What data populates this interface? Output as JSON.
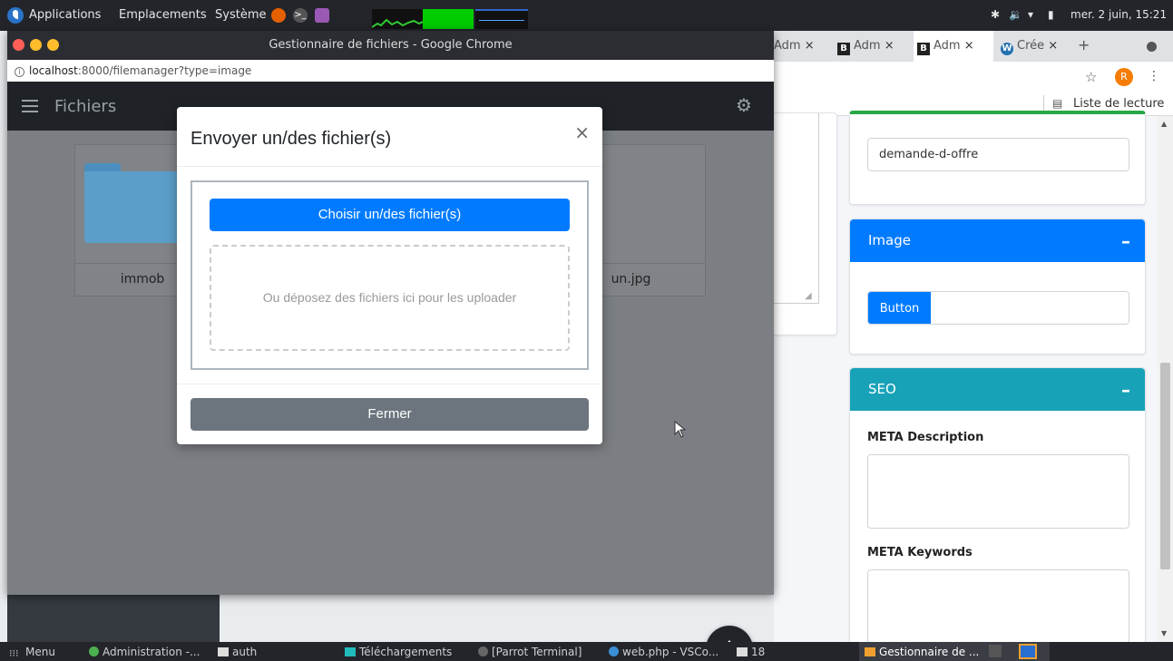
{
  "system_bar": {
    "menus": [
      "Applications",
      "Emplacements",
      "Système"
    ],
    "datetime": "mer. 2 juin, 15:21"
  },
  "file_manager_window": {
    "title": "Gestionnaire de fichiers - Google Chrome",
    "url_host": "localhost",
    "url_rest": ":8000/filemanager?type=image",
    "nav_title": "Fichiers",
    "files": [
      {
        "name": "immob",
        "kind": "folder"
      },
      {
        "name": "un.jpg",
        "kind": "image"
      }
    ],
    "fab_label": "+"
  },
  "modal": {
    "title": "Envoyer un/des fichier(s)",
    "close_label": "×",
    "choose_label": "Choisir un/des fichier(s)",
    "dropzone_text": "Ou déposez des fichiers ici pour les uploader",
    "close_button_label": "Fermer"
  },
  "background_browser": {
    "tabs": [
      {
        "label": "Adm",
        "icon": ""
      },
      {
        "label": "Adm",
        "icon": "B"
      },
      {
        "label": "Adm",
        "icon": "B"
      },
      {
        "label": "Crée",
        "icon": "W"
      }
    ],
    "new_tab_label": "+",
    "profile_initial": "R",
    "reading_list": "Liste de lecture",
    "slug_value": "demande-d-offre",
    "image_card": {
      "title": "Image",
      "button_label": "Button"
    },
    "seo_card": {
      "title": "SEO",
      "meta_description_label": "META Description",
      "meta_keywords_label": "META Keywords"
    },
    "colors": {
      "primary": "#007bff",
      "info": "#17a2b8",
      "success": "#28a745"
    }
  },
  "taskbar": {
    "items": [
      {
        "label": "Menu",
        "icon": "grid-icon"
      },
      {
        "label": "Administration -...",
        "icon": "chrome-icon"
      },
      {
        "label": "auth",
        "icon": "folder-icon"
      },
      {
        "label": "Téléchargements",
        "icon": "folder-icon"
      },
      {
        "label": "[Parrot Terminal]",
        "icon": "terminal-icon"
      },
      {
        "label": "web.php - VSCo...",
        "icon": "vscode-icon"
      },
      {
        "label": "18",
        "icon": "folder-icon"
      },
      {
        "label": "Gestionnaire de ...",
        "icon": "window-icon"
      }
    ]
  }
}
